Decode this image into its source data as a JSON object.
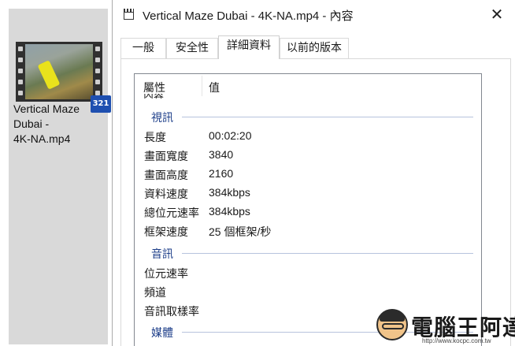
{
  "file": {
    "name": "Vertical Maze Dubai - 4K-NA.mp4",
    "name_lines": [
      "Vertical Maze",
      "Dubai -",
      "4K-NA.mp4"
    ],
    "badge": "321"
  },
  "window": {
    "title": "Vertical Maze Dubai - 4K-NA.mp4 - 內容",
    "close_label": "✕"
  },
  "tabs": [
    {
      "label": "一般",
      "active": false
    },
    {
      "label": "安全性",
      "active": false
    },
    {
      "label": "詳細資料",
      "active": true
    },
    {
      "label": "以前的版本",
      "active": false
    }
  ],
  "columns": {
    "property": "屬性",
    "value": "值"
  },
  "clipped_row": "內容",
  "groups": {
    "video": {
      "label": "視訊",
      "rows": [
        {
          "key": "長度",
          "value": "00:02:20"
        },
        {
          "key": "畫面寬度",
          "value": "3840"
        },
        {
          "key": "畫面高度",
          "value": "2160"
        },
        {
          "key": "資料速度",
          "value": "384kbps"
        },
        {
          "key": "總位元速率",
          "value": "384kbps"
        },
        {
          "key": "框架速度",
          "value": "25 個框架/秒"
        }
      ]
    },
    "audio": {
      "label": "音訊",
      "rows": [
        {
          "key": "位元速率",
          "value": ""
        },
        {
          "key": "頻道",
          "value": ""
        },
        {
          "key": "音訊取樣率",
          "value": ""
        }
      ]
    },
    "media": {
      "label": "媒體"
    }
  },
  "scrollbar": {
    "up_arrow": "▲"
  },
  "watermark": {
    "title": "電腦王阿達",
    "url": "http://www.kocpc.com.tw"
  }
}
